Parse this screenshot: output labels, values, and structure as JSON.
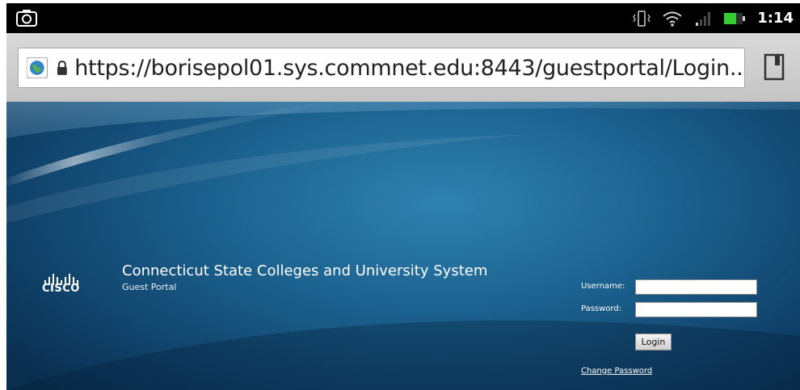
{
  "status_bar": {
    "time": "1:14",
    "icons": [
      "camera-icon",
      "vibrate-icon",
      "wifi-icon",
      "signal-icon",
      "battery-icon"
    ]
  },
  "browser": {
    "url": "https://borisepol01.sys.commnet.edu:8443/guestportal/Login....",
    "icons": [
      "globe-icon",
      "lock-icon",
      "bookmarks-icon"
    ]
  },
  "portal": {
    "logo_text": "CISCO",
    "title": "Connecticut State Colleges and University System",
    "subtitle": "Guest Portal",
    "username_label": "Username:",
    "username_value": "",
    "password_label": "Password:",
    "password_value": "",
    "login_label": "Login",
    "change_password_label": "Change Password"
  },
  "colors": {
    "status_bar_bg": "#000000",
    "url_bar_bg": "#d0d0d0",
    "portal_bg": "#1a5f8c",
    "battery": "#33cc33"
  }
}
